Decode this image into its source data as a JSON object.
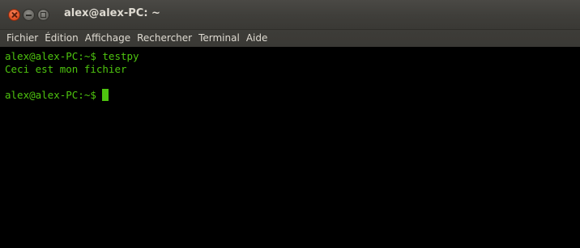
{
  "window": {
    "title": "alex@alex-PC: ~"
  },
  "menubar": {
    "items": [
      "Fichier",
      "Édition",
      "Affichage",
      "Rechercher",
      "Terminal",
      "Aide"
    ]
  },
  "terminal": {
    "lines": [
      "alex@alex-PC:~$ testpy",
      "Ceci est mon fichier",
      "",
      "alex@alex-PC:~$ "
    ],
    "text_color": "#4ec40f",
    "background": "#000000"
  },
  "icons": {
    "close": "close-icon",
    "minimize": "minimize-icon",
    "maximize": "maximize-icon"
  }
}
